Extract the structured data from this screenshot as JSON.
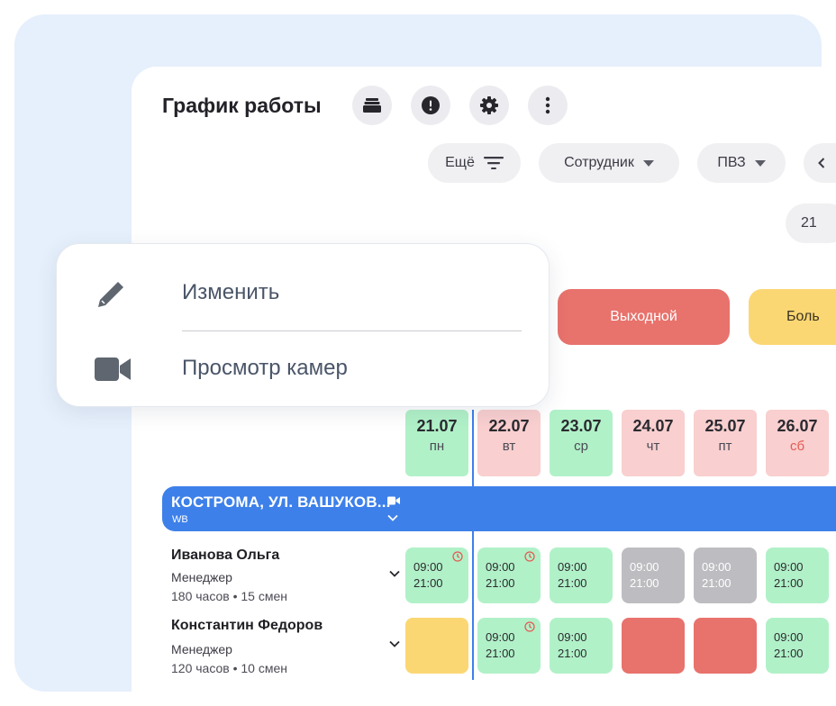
{
  "header": {
    "title": "График работы",
    "icons": [
      "stack-icon",
      "alert-icon",
      "gear-icon",
      "more-vertical-icon"
    ]
  },
  "filters": {
    "more_label": "Ещё",
    "employee_label": "Сотрудник",
    "pvz_label": "ПВЗ"
  },
  "date_chip": "21",
  "legend": {
    "day_off": "Выходной",
    "sick_partial": "Боль"
  },
  "days": [
    {
      "date": "21.07",
      "weekday": "пн"
    },
    {
      "date": "22.07",
      "weekday": "вт"
    },
    {
      "date": "23.07",
      "weekday": "ср"
    },
    {
      "date": "24.07",
      "weekday": "чт"
    },
    {
      "date": "25.07",
      "weekday": "пт"
    },
    {
      "date": "26.07",
      "weekday": "сб"
    }
  ],
  "branch": {
    "name": "КОСТРОМА, УЛ. ВАШУКОВ...",
    "sub": "WB"
  },
  "employees": [
    {
      "name": "Иванова Ольга",
      "role": "Менеджер",
      "meta": "180 часов • 15 смен",
      "shifts": [
        {
          "start": "09:00",
          "end": "21:00"
        },
        {
          "start": "09:00",
          "end": "21:00"
        },
        {
          "start": "09:00",
          "end": "21:00"
        },
        {
          "start": "09:00",
          "end": "21:00"
        },
        {
          "start": "09:00",
          "end": "21:00"
        },
        {
          "start": "09:00",
          "end": "21:00"
        }
      ]
    },
    {
      "name": "Константин Федоров",
      "role": "Менеджер",
      "meta": "120 часов • 10 смен",
      "shifts": [
        {
          "start": "",
          "end": ""
        },
        {
          "start": "09:00",
          "end": "21:00"
        },
        {
          "start": "09:00",
          "end": "21:00"
        },
        {
          "start": "",
          "end": ""
        },
        {
          "start": "",
          "end": ""
        },
        {
          "start": "09:00",
          "end": "21:00"
        }
      ]
    }
  ],
  "context_menu": {
    "edit_label": "Изменить",
    "cameras_label": "Просмотр камер"
  },
  "colors": {
    "accent": "#3d80ea",
    "shift_green": "#b1f1c8",
    "day_off_red": "#e8726c",
    "sick_yellow": "#fbd774",
    "past_gray": "#bdbdc1",
    "weekend_pink": "#f9cfcf"
  }
}
